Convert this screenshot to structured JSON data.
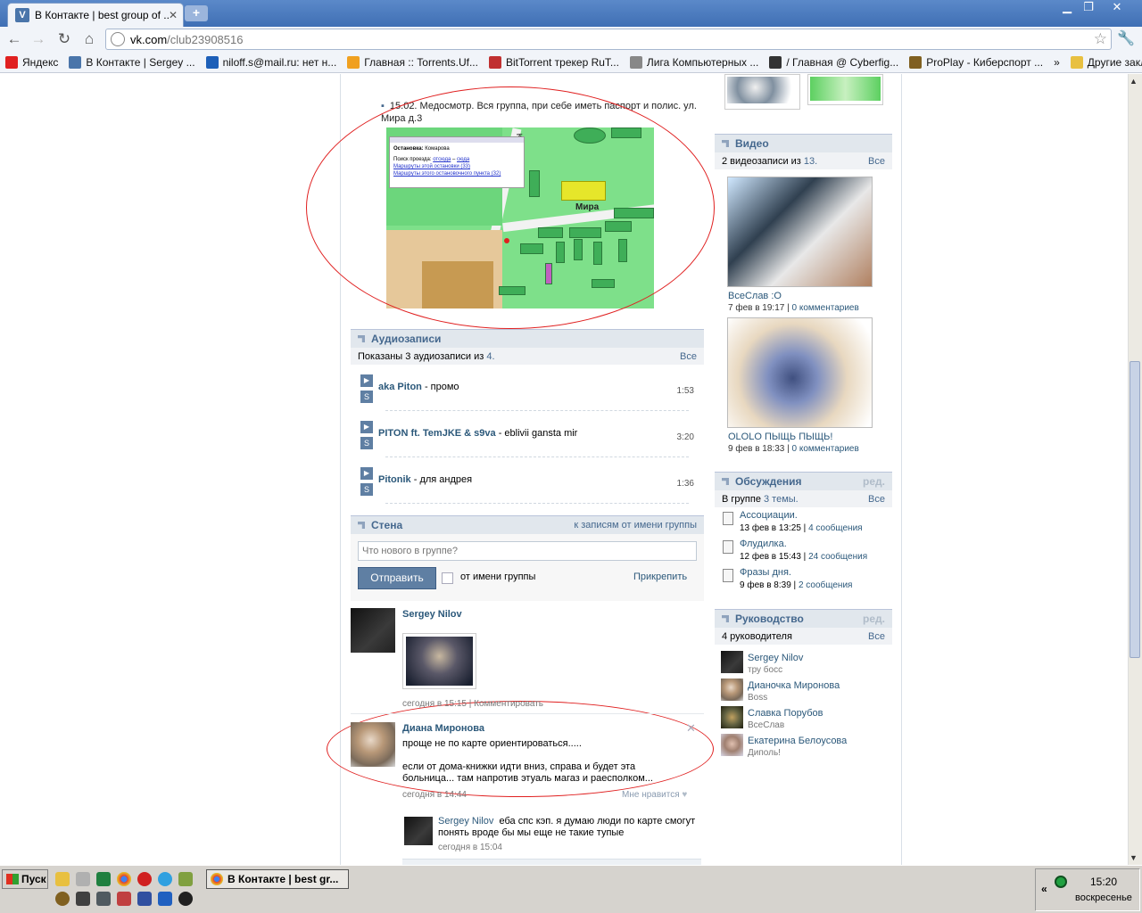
{
  "browser": {
    "tab_title": "В Контакте | best group of ...",
    "tab_favicon": "V",
    "url_host": "vk.com",
    "url_path": "/club23908516",
    "bookmarks": [
      {
        "label": "Яндекс",
        "icon": "yandex-icon",
        "color": "#e02020"
      },
      {
        "label": "В Контакте | Sergey ...",
        "icon": "vk-icon",
        "color": "#4a75aa"
      },
      {
        "label": "niloff.s@mail.ru: нет н...",
        "icon": "mail-icon",
        "color": "#1d5fb8"
      },
      {
        "label": "Главная :: Torrents.Uf...",
        "icon": "torrents-icon",
        "color": "#f0a020"
      },
      {
        "label": "BitTorrent трекер RuT...",
        "icon": "rutracker-icon",
        "color": "#c03030"
      },
      {
        "label": "Лига Компьютерных ...",
        "icon": "globe-icon",
        "color": "#888888"
      },
      {
        "label": "/ Главная @ Cyberfig...",
        "icon": "cyberfight-icon",
        "color": "#333333"
      },
      {
        "label": "ProPlay - Киберспорт ...",
        "icon": "proplay-icon",
        "color": "#806020"
      }
    ],
    "other_bookmarks": "Другие закладки",
    "chevron": "»"
  },
  "post_top": {
    "bullet_text": "15.02. Медосмотр. Вся группа, при себе иметь паспорт и полис. ул. Мира д.3",
    "map": {
      "popup_title_label": "Остановка:",
      "popup_title_value": "Комарова",
      "popup_search_label": "Поиск проезда:",
      "popup_from": "отсюда",
      "popup_dash": "–",
      "popup_to": "сюда",
      "popup_link1": "Маршруты этой остановки (33)",
      "popup_link2": "Маршруты этого остановочного пункта (32)",
      "street_mira": "Мира",
      "street_komarova": "Комарова"
    }
  },
  "audio": {
    "header": "Аудиозаписи",
    "count_prefix": "Показаны 3 аудиозаписи из",
    "count_total": "4.",
    "all": "Все",
    "tracks": [
      {
        "artist": "aka Piton",
        "title": " - промо",
        "duration": "1:53"
      },
      {
        "artist": "PITON ft. TemJKE & s9va",
        "title": " - eblivii gansta mir",
        "duration": "3:20"
      },
      {
        "artist": "Pitonik",
        "title": " - для андрея",
        "duration": "1:36"
      }
    ]
  },
  "wall": {
    "header": "Стена",
    "header_link": "к записям от имени группы",
    "input_placeholder": "Что нового в группе?",
    "submit": "Отправить",
    "as_group": "от имени группы",
    "attach": "Прикрепить",
    "posts": [
      {
        "author": "Sergey Nilov",
        "time": "сегодня в 15:15",
        "comment": "Комментировать"
      },
      {
        "author": "Диана Миронова",
        "line1": "проще не по карте ориентироваться.....",
        "line2": "если от дома-книжки идти вниз, справа и будет эта",
        "line3": "больница... там напротив этуаль магаз и раесполком...",
        "time": "сегодня в 14:44",
        "like": "Мне нравится"
      }
    ],
    "reply": {
      "author": "Sergey Nilov",
      "text1": "еба спс кэп. я думаю люди по карте смогут",
      "text2": "понять вроде бы мы еще не такие тупые",
      "time": "сегодня в 15:04"
    }
  },
  "video": {
    "header": "Видео",
    "count": "2 видеозаписи из",
    "total": "13.",
    "all": "Все",
    "items": [
      {
        "title": "ВсеСлав :О",
        "date": "7 фев в 19:17",
        "comments": "0 комментариев"
      },
      {
        "title": "OLOLO ПЫЩЬ ПЫЩЬ!",
        "date": "9 фев в 18:33",
        "comments": "0 комментариев"
      }
    ]
  },
  "discussions": {
    "header": "Обсуждения",
    "edit": "ред.",
    "count_prefix": "В группе",
    "count": "3 темы.",
    "all": "Все",
    "topics": [
      {
        "title": "Ассоциации.",
        "date": "13 фев в 13:25",
        "posts": "4 сообщения"
      },
      {
        "title": "Флудилка.",
        "date": "12 фев в 15:43",
        "posts": "24 сообщения"
      },
      {
        "title": "Фразы дня.",
        "date": "9 фев в 8:39",
        "posts": "2 сообщения"
      }
    ]
  },
  "leaders": {
    "header": "Руководство",
    "edit": "ред.",
    "count": "4 руководителя",
    "all": "Все",
    "people": [
      {
        "name": "Sergey Nilov",
        "role": "тру босс"
      },
      {
        "name": "Дианочка Миронова",
        "role": "Boss"
      },
      {
        "name": "Славка Порубов",
        "role": "ВсеСлав"
      },
      {
        "name": "Екатерина Белоусова",
        "role": "Диполь!"
      }
    ]
  },
  "taskbar": {
    "start": "Пуск",
    "active_window": "В Контакте | best gr...",
    "clock": "15:20",
    "day": "воскресенье",
    "tray_arrow": "«"
  }
}
